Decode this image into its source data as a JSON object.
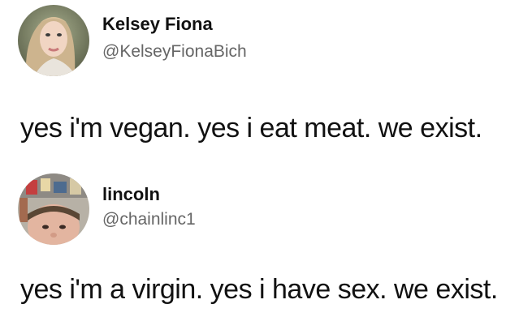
{
  "tweets": [
    {
      "display_name": "Kelsey Fiona",
      "handle": "@KelseyFionaBich",
      "text": "yes i'm vegan. yes i eat meat. we exist.",
      "avatar_icon": "profile-photo"
    },
    {
      "display_name": "lincoln",
      "handle": "@chainlinc1",
      "text": "yes i'm a virgin. yes i have sex. we exist.",
      "avatar_icon": "profile-photo"
    }
  ]
}
